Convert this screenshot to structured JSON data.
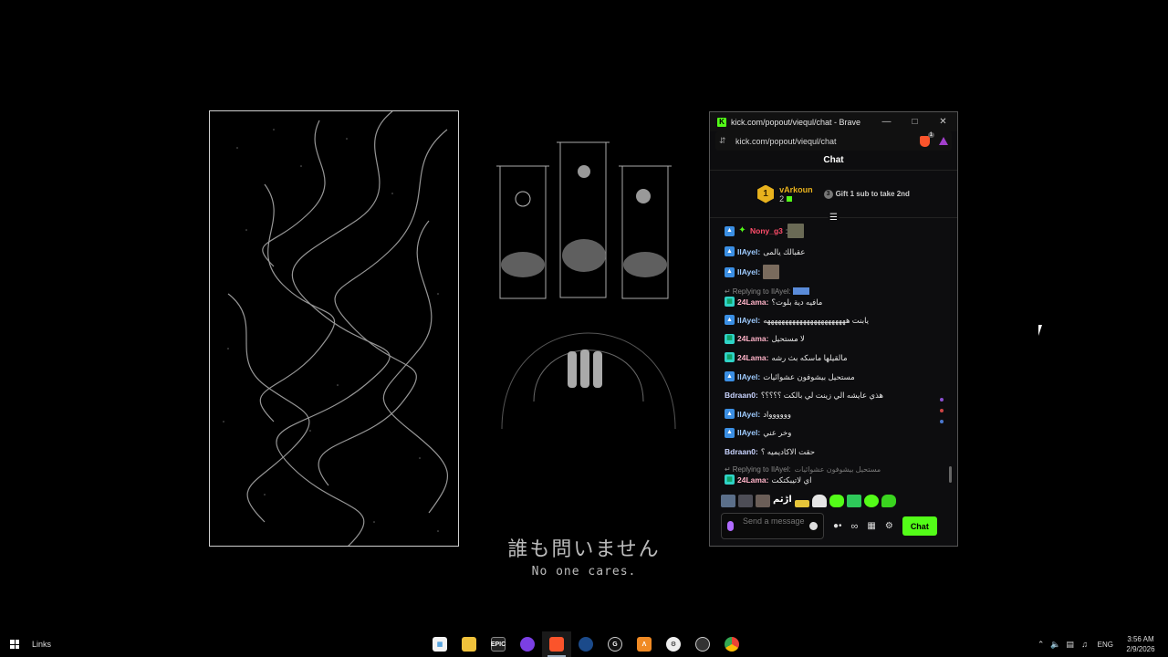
{
  "wallpaper": {
    "jp_caption": "誰も問いません",
    "en_caption": "No one cares."
  },
  "browser": {
    "window_title": "kick.com/popout/viequl/chat - Brave",
    "url": "kick.com/popout/viequl/chat",
    "shield_count": "1",
    "brand_color": "#53fc18"
  },
  "chat": {
    "header": "Chat",
    "leaderboard": {
      "rank": "1",
      "user": "vArkoun",
      "count": "2",
      "gift_icon": "3",
      "gift_text": "Gift 1 sub to take 2nd"
    },
    "messages": [
      {
        "user": "Nony_g3",
        "text": ":",
        "user_color": "#ff4d6a",
        "emote": true
      },
      {
        "user": "IlAyel:",
        "text": "عقبالك يالمى"
      },
      {
        "user": "IlAyel:",
        "text": "",
        "emote": true
      },
      {
        "reply_to": "Replying to IlAyel:",
        "user": "24Lama:",
        "text": "مافيه دية بلوت؟"
      },
      {
        "user": "IlAyel:",
        "text": "يابنت هههههههههههههههههههههههه"
      },
      {
        "user": "24Lama:",
        "text": "لا مستحيل"
      },
      {
        "user": "24Lama:",
        "text": "مالقيلها ماسكه بث رشه"
      },
      {
        "user": "IlAyel:",
        "text": "مستحيل بيشوفون عشوائيات"
      },
      {
        "user": "Bdraan0:",
        "text": "هذي عايشه الي زينت لي بالكت ؟؟؟؟؟"
      },
      {
        "user": "IlAyel:",
        "text": "وووووواد"
      },
      {
        "user": "IlAyel:",
        "text": "وخر عني"
      },
      {
        "user": "Bdraan0:",
        "text": "حقت الاكاديميه ؟"
      },
      {
        "reply_to": "Replying to IlAyel:",
        "reply_quote": "مستحيل بيشوفون عشوائيات",
        "user": "24Lama:",
        "text": "اي لاتيبكتكت"
      }
    ],
    "emote_bar_word": "اڑثم",
    "send_placeholder": "Send a message",
    "chat_button": "Chat",
    "infinity": "∞"
  },
  "taskbar": {
    "links_label": "Links",
    "apps": [
      "microsoft-store",
      "file-explorer",
      "epic-games",
      "app-purple",
      "brave",
      "steam",
      "epic-g",
      "aimp",
      "steelseries",
      "obs",
      "chrome"
    ],
    "epic_label": "EPIC",
    "language": "ENG",
    "time": "3:56 AM",
    "date": "2/9/2026"
  }
}
